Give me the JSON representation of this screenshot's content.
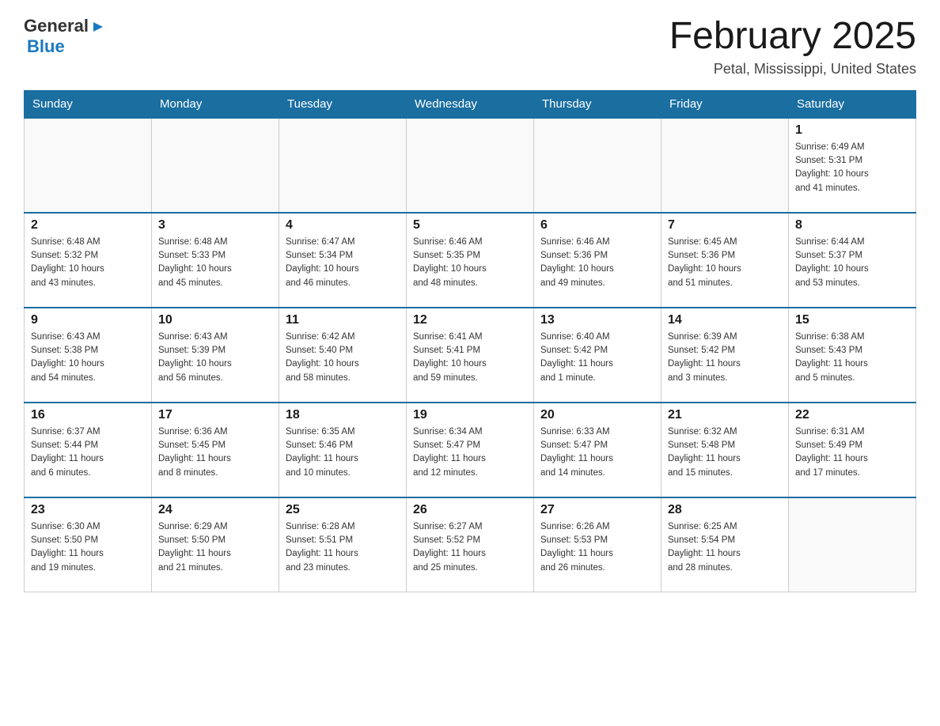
{
  "header": {
    "logo": {
      "general": "General",
      "blue": "Blue",
      "triangle": "▶"
    },
    "title": "February 2025",
    "location": "Petal, Mississippi, United States"
  },
  "calendar": {
    "weekdays": [
      "Sunday",
      "Monday",
      "Tuesday",
      "Wednesday",
      "Thursday",
      "Friday",
      "Saturday"
    ],
    "weeks": [
      [
        {
          "day": "",
          "info": ""
        },
        {
          "day": "",
          "info": ""
        },
        {
          "day": "",
          "info": ""
        },
        {
          "day": "",
          "info": ""
        },
        {
          "day": "",
          "info": ""
        },
        {
          "day": "",
          "info": ""
        },
        {
          "day": "1",
          "info": "Sunrise: 6:49 AM\nSunset: 5:31 PM\nDaylight: 10 hours\nand 41 minutes."
        }
      ],
      [
        {
          "day": "2",
          "info": "Sunrise: 6:48 AM\nSunset: 5:32 PM\nDaylight: 10 hours\nand 43 minutes."
        },
        {
          "day": "3",
          "info": "Sunrise: 6:48 AM\nSunset: 5:33 PM\nDaylight: 10 hours\nand 45 minutes."
        },
        {
          "day": "4",
          "info": "Sunrise: 6:47 AM\nSunset: 5:34 PM\nDaylight: 10 hours\nand 46 minutes."
        },
        {
          "day": "5",
          "info": "Sunrise: 6:46 AM\nSunset: 5:35 PM\nDaylight: 10 hours\nand 48 minutes."
        },
        {
          "day": "6",
          "info": "Sunrise: 6:46 AM\nSunset: 5:36 PM\nDaylight: 10 hours\nand 49 minutes."
        },
        {
          "day": "7",
          "info": "Sunrise: 6:45 AM\nSunset: 5:36 PM\nDaylight: 10 hours\nand 51 minutes."
        },
        {
          "day": "8",
          "info": "Sunrise: 6:44 AM\nSunset: 5:37 PM\nDaylight: 10 hours\nand 53 minutes."
        }
      ],
      [
        {
          "day": "9",
          "info": "Sunrise: 6:43 AM\nSunset: 5:38 PM\nDaylight: 10 hours\nand 54 minutes."
        },
        {
          "day": "10",
          "info": "Sunrise: 6:43 AM\nSunset: 5:39 PM\nDaylight: 10 hours\nand 56 minutes."
        },
        {
          "day": "11",
          "info": "Sunrise: 6:42 AM\nSunset: 5:40 PM\nDaylight: 10 hours\nand 58 minutes."
        },
        {
          "day": "12",
          "info": "Sunrise: 6:41 AM\nSunset: 5:41 PM\nDaylight: 10 hours\nand 59 minutes."
        },
        {
          "day": "13",
          "info": "Sunrise: 6:40 AM\nSunset: 5:42 PM\nDaylight: 11 hours\nand 1 minute."
        },
        {
          "day": "14",
          "info": "Sunrise: 6:39 AM\nSunset: 5:42 PM\nDaylight: 11 hours\nand 3 minutes."
        },
        {
          "day": "15",
          "info": "Sunrise: 6:38 AM\nSunset: 5:43 PM\nDaylight: 11 hours\nand 5 minutes."
        }
      ],
      [
        {
          "day": "16",
          "info": "Sunrise: 6:37 AM\nSunset: 5:44 PM\nDaylight: 11 hours\nand 6 minutes."
        },
        {
          "day": "17",
          "info": "Sunrise: 6:36 AM\nSunset: 5:45 PM\nDaylight: 11 hours\nand 8 minutes."
        },
        {
          "day": "18",
          "info": "Sunrise: 6:35 AM\nSunset: 5:46 PM\nDaylight: 11 hours\nand 10 minutes."
        },
        {
          "day": "19",
          "info": "Sunrise: 6:34 AM\nSunset: 5:47 PM\nDaylight: 11 hours\nand 12 minutes."
        },
        {
          "day": "20",
          "info": "Sunrise: 6:33 AM\nSunset: 5:47 PM\nDaylight: 11 hours\nand 14 minutes."
        },
        {
          "day": "21",
          "info": "Sunrise: 6:32 AM\nSunset: 5:48 PM\nDaylight: 11 hours\nand 15 minutes."
        },
        {
          "day": "22",
          "info": "Sunrise: 6:31 AM\nSunset: 5:49 PM\nDaylight: 11 hours\nand 17 minutes."
        }
      ],
      [
        {
          "day": "23",
          "info": "Sunrise: 6:30 AM\nSunset: 5:50 PM\nDaylight: 11 hours\nand 19 minutes."
        },
        {
          "day": "24",
          "info": "Sunrise: 6:29 AM\nSunset: 5:50 PM\nDaylight: 11 hours\nand 21 minutes."
        },
        {
          "day": "25",
          "info": "Sunrise: 6:28 AM\nSunset: 5:51 PM\nDaylight: 11 hours\nand 23 minutes."
        },
        {
          "day": "26",
          "info": "Sunrise: 6:27 AM\nSunset: 5:52 PM\nDaylight: 11 hours\nand 25 minutes."
        },
        {
          "day": "27",
          "info": "Sunrise: 6:26 AM\nSunset: 5:53 PM\nDaylight: 11 hours\nand 26 minutes."
        },
        {
          "day": "28",
          "info": "Sunrise: 6:25 AM\nSunset: 5:54 PM\nDaylight: 11 hours\nand 28 minutes."
        },
        {
          "day": "",
          "info": ""
        }
      ]
    ]
  }
}
